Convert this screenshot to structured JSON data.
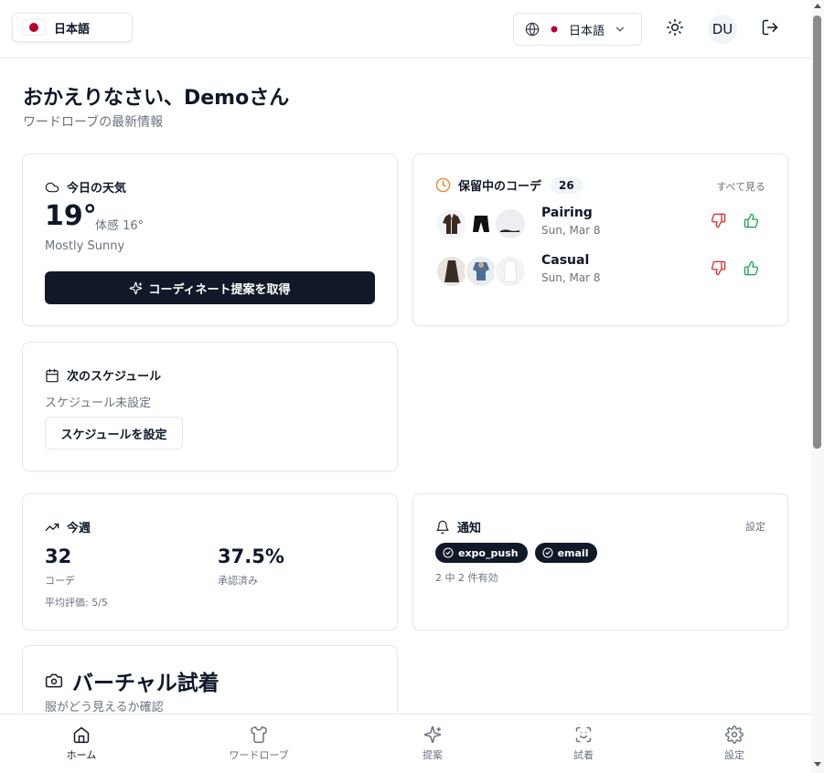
{
  "header": {
    "language_chip": "日本語",
    "language_select": "日本語",
    "avatar_initials": "DU"
  },
  "greeting": {
    "title": "おかえりなさい、Demoさん",
    "subtitle": "ワードローブの最新情報"
  },
  "weather": {
    "title": "今日の天気",
    "temperature": "19°",
    "feels_like": "体感 16°",
    "condition": "Mostly Sunny",
    "suggest_button": "コーディネート提案を取得"
  },
  "saved_outfits": {
    "title": "保留中のコーデ",
    "count": "26",
    "see_all": "すべて見る",
    "items": [
      {
        "name": "Pairing",
        "date": "Sun, Mar 8"
      },
      {
        "name": "Casual",
        "date": "Sun, Mar 8"
      }
    ]
  },
  "schedule": {
    "title": "次のスケジュール",
    "empty_text": "スケジュール未設定",
    "set_button": "スケジュールを設定"
  },
  "weekly_stats": {
    "title": "今週",
    "outfits_value": "32",
    "outfits_label": "コーデ",
    "approved_value": "37.5%",
    "approved_label": "承認済み",
    "average_rating": "平均評価: 5/5"
  },
  "notifications": {
    "title": "通知",
    "settings_link": "設定",
    "channels": [
      "expo_push",
      "email"
    ],
    "enabled_summary": "2 中 2 件有効"
  },
  "virtual_tryon": {
    "title": "バーチャル試着",
    "subtitle": "服がどう見えるか確認"
  },
  "bottom_nav": {
    "items": [
      {
        "label": "ホーム",
        "icon": "home-icon",
        "active": true
      },
      {
        "label": "ワードローブ",
        "icon": "shirt-icon",
        "active": false
      },
      {
        "label": "提案",
        "icon": "sparkles-icon",
        "active": false
      },
      {
        "label": "試着",
        "icon": "face-scan-icon",
        "active": false
      },
      {
        "label": "設定",
        "icon": "gear-icon",
        "active": false
      }
    ]
  },
  "colors": {
    "primary": "#111827",
    "muted_text": "#6b7280",
    "border": "#e5e7eb",
    "pending_clock": "#ea8a2e",
    "dislike_red": "#dc2626",
    "like_green": "#16a34a",
    "flag_red": "#bc002d"
  }
}
